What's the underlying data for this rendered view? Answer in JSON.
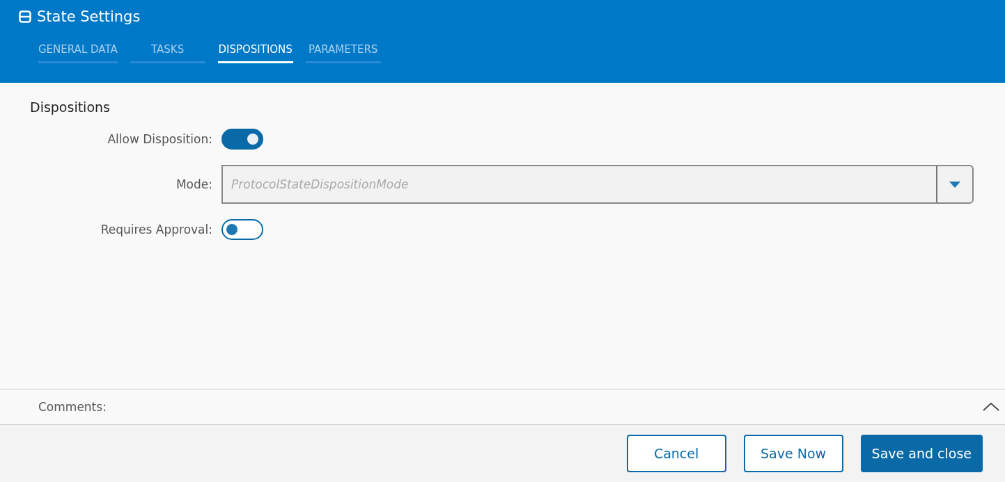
{
  "window": {
    "title": "State Settings"
  },
  "tabs": [
    {
      "label": "GENERAL DATA",
      "selected": false
    },
    {
      "label": "TASKS",
      "selected": false
    },
    {
      "label": "DISPOSITIONS",
      "selected": true
    },
    {
      "label": "PARAMETERS",
      "selected": false
    }
  ],
  "section": {
    "title": "Dispositions"
  },
  "fields": [
    {
      "kind": "toggle",
      "label": "Allow Disposition:",
      "on": true
    },
    {
      "kind": "select",
      "label": "Mode:",
      "placeholder": "ProtocolStateDispositionMode"
    },
    {
      "kind": "toggle",
      "label": "Requires Approval:",
      "on": false
    }
  ],
  "comments": {
    "label": "Comments:"
  },
  "buttons": [
    {
      "label": "Cancel",
      "kind": "secondary"
    },
    {
      "label": "Save Now",
      "kind": "secondary"
    },
    {
      "label": "Save and close",
      "kind": "primary"
    }
  ]
}
